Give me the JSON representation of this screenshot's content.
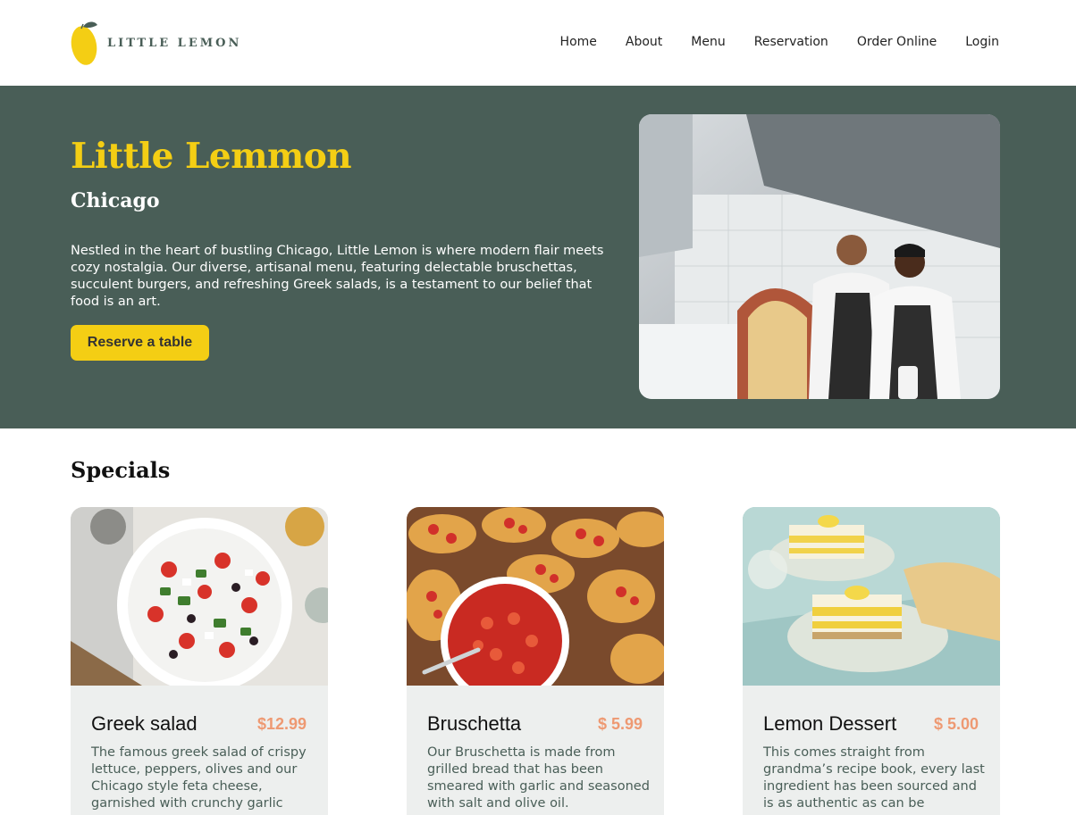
{
  "brand": {
    "name": "LITTLE LEMON"
  },
  "nav": {
    "items": [
      "Home",
      "About",
      "Menu",
      "Reservation",
      "Order Online",
      "Login"
    ]
  },
  "hero": {
    "title": "Little Lemmon",
    "subtitle": "Chicago",
    "description": "Nestled in the heart of bustling Chicago, Little Lemon is where modern flair meets cozy nostalgia. Our diverse, artisanal menu, featuring delectable bruschettas, succulent burgers, and refreshing Greek salads, is a testament to our belief that food is an art.",
    "button_label": "Reserve a table"
  },
  "specials": {
    "title": "Specials",
    "items": [
      {
        "name": "Greek salad",
        "price": "$12.99",
        "description": "The famous greek salad of crispy lettuce, peppers, olives and our Chicago style feta cheese, garnished with crunchy garlic"
      },
      {
        "name": "Bruschetta",
        "price": "$ 5.99",
        "description": "Our Bruschetta is made from grilled bread that has been smeared with garlic and seasoned with salt and olive oil."
      },
      {
        "name": "Lemon Dessert",
        "price": "$ 5.00",
        "description": "This comes straight from grandma’s recipe book, every last ingredient has been sourced and is as authentic as can be"
      }
    ]
  },
  "colors": {
    "primary_green": "#495e57",
    "primary_yellow": "#f4ce14",
    "accent_salmon": "#ee9972",
    "card_bg": "#edefee"
  }
}
